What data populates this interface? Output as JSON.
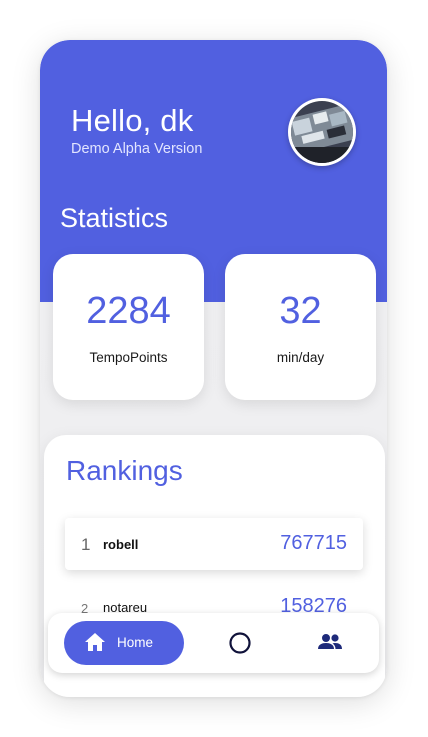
{
  "header": {
    "greeting": "Hello, dk",
    "version": "Demo Alpha Version",
    "avatar_icon": "profile-photo"
  },
  "statistics": {
    "title": "Statistics",
    "cards": [
      {
        "value": "2284",
        "label": "TempoPoints"
      },
      {
        "value": "32",
        "label": "min/day"
      }
    ]
  },
  "rankings": {
    "title": "Rankings",
    "rows": [
      {
        "rank": "1",
        "name": "robell",
        "score": "767715"
      },
      {
        "rank": "2",
        "name": "notareu",
        "score": "158276"
      }
    ]
  },
  "nav": {
    "home_label": "Home",
    "home_icon": "home-icon",
    "middle_icon": "circle-icon",
    "right_icon": "people-icon"
  },
  "colors": {
    "accent": "#5160e0",
    "background": "#f1f1f3",
    "card": "#ffffff"
  }
}
